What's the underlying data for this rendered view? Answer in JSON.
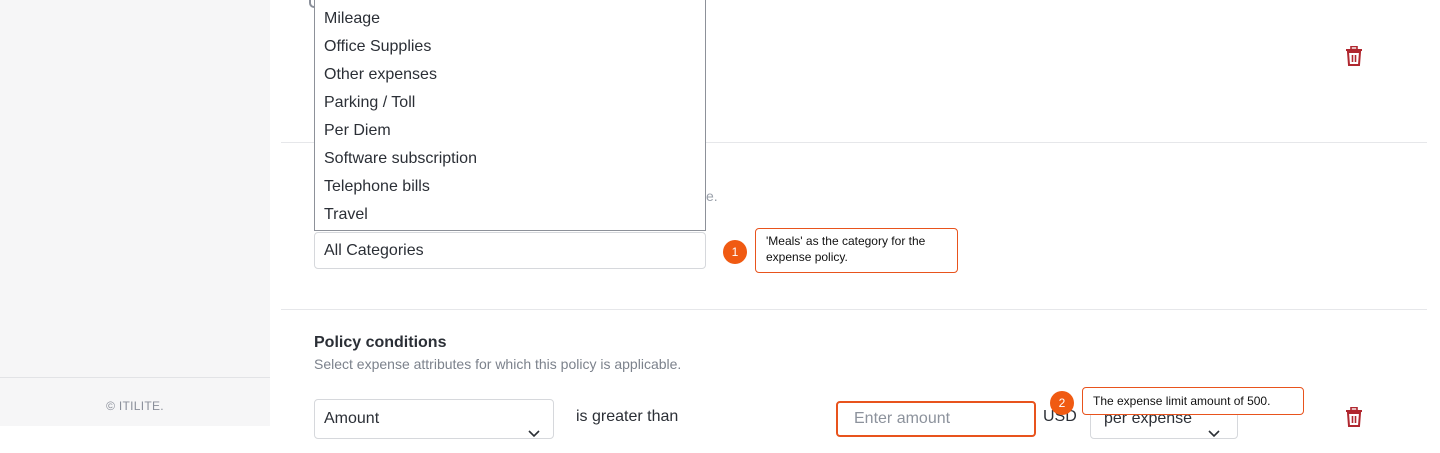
{
  "sidebar": {
    "footer": "© ITILITE."
  },
  "category_dropdown": {
    "options": [
      "Mileage",
      "Office Supplies",
      "Other expenses",
      "Parking / Toll",
      "Per Diem",
      "Software subscription",
      "Telephone bills",
      "Travel"
    ],
    "selected_value": "All Categories",
    "faded_suffix": "e."
  },
  "policy_conditions": {
    "title": "Policy conditions",
    "subtitle": "Select expense attributes for which this policy is applicable.",
    "row": {
      "attribute": "Amount",
      "operator": "is greater than",
      "amount_placeholder": "Enter amount",
      "currency": "USD",
      "frequency": "per expense"
    }
  },
  "annotations": [
    {
      "number": "1",
      "text": "'Meals' as the category for the expense policy."
    },
    {
      "number": "2",
      "text": "The expense limit amount of 500."
    }
  ],
  "colors": {
    "accent": "#e8531d",
    "badge": "#f05a12",
    "delete": "#b0272f"
  },
  "icons": {
    "delete": "trash-icon",
    "dropdown": "chevron-down-icon",
    "radio": "radio-icon"
  }
}
